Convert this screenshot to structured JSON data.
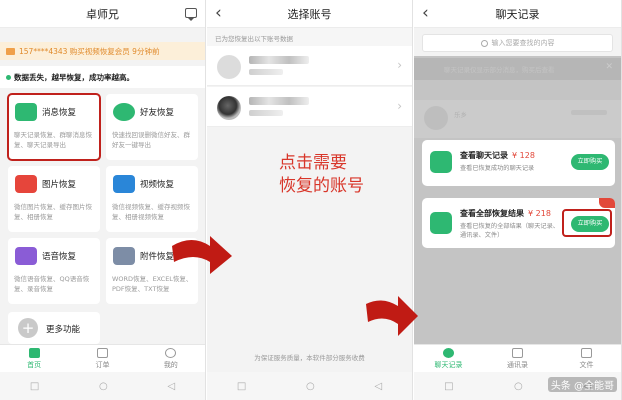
{
  "home": {
    "title": "卓师兄",
    "notice": "157****4343 购买视频恢复会员  9分钟前",
    "slogan": "数据丢失，越早恢复，成功率越高。",
    "cards": [
      {
        "title": "消息恢复",
        "desc": "聊天记录恢复、群聊消息恢复、聊天记录导出",
        "icon": "chat-icon",
        "color": "#2eb872"
      },
      {
        "title": "好友恢复",
        "desc": "快速找回误删微信好友、群好友一键导出",
        "icon": "friend-icon",
        "color": "#2eb872"
      },
      {
        "title": "图片恢复",
        "desc": "微信图片恢复、缓存图片恢复、相册恢复",
        "icon": "image-icon",
        "color": "#e6453b"
      },
      {
        "title": "视频恢复",
        "desc": "微信视频恢复、缓存视频恢复、相册视频恢复",
        "icon": "video-icon",
        "color": "#2a86d8"
      },
      {
        "title": "语音恢复",
        "desc": "微信语音恢复、QQ语音恢复、录音恢复",
        "icon": "voice-icon",
        "color": "#8a5cd6"
      },
      {
        "title": "附件恢复",
        "desc": "WORD恢复、EXCEL恢复、PDF恢复、TXT恢复",
        "icon": "file-icon",
        "color": "#7d8da6"
      }
    ],
    "more": "更多功能",
    "tabs": [
      "首页",
      "订单",
      "我的"
    ]
  },
  "select": {
    "title": "选择账号",
    "subtitle": "已为您恢复出以下账号数据",
    "overlay_line1": "点击需要",
    "overlay_line2": "恢复的账号",
    "footer": "为保证服务质量，本软件部分服务收费"
  },
  "chats": {
    "title": "聊天记录",
    "search_placeholder": "输入您要查找的内容",
    "blurred_banner": "聊天记录仅显示部分消息，购买后查看",
    "blurred_name": "乐乡",
    "offers": [
      {
        "title": "查看聊天记录",
        "price": "¥ 128",
        "desc": "查看已恢复成功的聊天记录",
        "button": "立即购买"
      },
      {
        "title": "查看全部恢复结果",
        "price": "¥ 218",
        "desc": "查看已恢复的全部结果（聊天记录、通讯录、文件）",
        "button": "立即购买"
      }
    ],
    "tabs": [
      "聊天记录",
      "通讯录",
      "文件"
    ],
    "watermark": "头条 @全能哥"
  },
  "colors": {
    "accent": "#2eb872",
    "annotation": "#c0211c",
    "price": "#e2483a"
  }
}
